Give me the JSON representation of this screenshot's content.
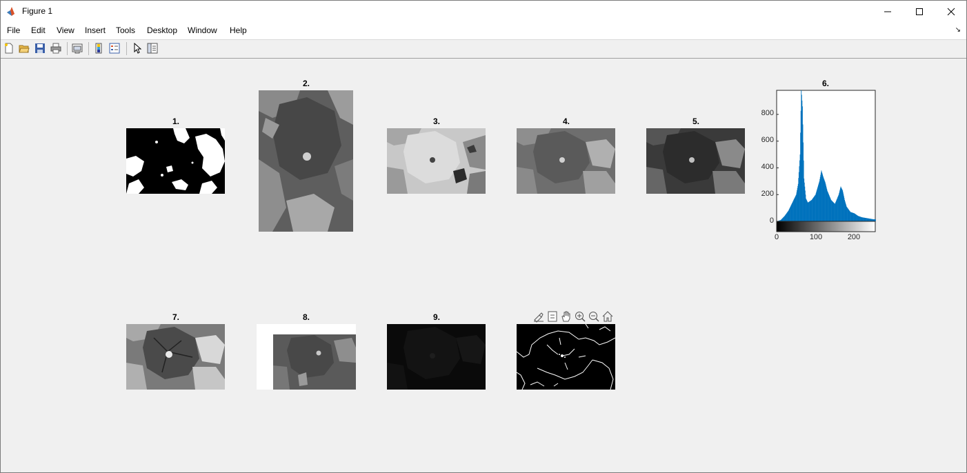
{
  "window": {
    "title": "Figure 1",
    "buttons": [
      "minimize",
      "maximize",
      "close"
    ]
  },
  "menu": {
    "items": [
      "File",
      "Edit",
      "View",
      "Insert",
      "Tools",
      "Desktop",
      "Window",
      "Help"
    ]
  },
  "toolbar": {
    "buttons": [
      "new-figure-icon",
      "open-file-icon",
      "save-icon",
      "print-icon",
      "link-plot-icon",
      "insert-colorbar-icon",
      "insert-legend-icon",
      "edit-plot-icon",
      "property-inspector-icon"
    ]
  },
  "subplots": {
    "t1": "1.",
    "t2": "2.",
    "t3": "3.",
    "t4": "4.",
    "t5": "5.",
    "t6": "6.",
    "t7": "7.",
    "t8": "8.",
    "t9": "9."
  },
  "histogram": {
    "yticks": [
      "0",
      "200",
      "400",
      "600",
      "800"
    ],
    "xticks": [
      "0",
      "100",
      "200"
    ]
  },
  "axes_toolbar": [
    "brush-icon",
    "data-tips-icon",
    "pan-icon",
    "zoom-in-icon",
    "zoom-out-icon",
    "home-icon"
  ],
  "chart_data": {
    "type": "bar",
    "title": "6.",
    "xlabel": "",
    "ylabel": "",
    "xlim": [
      0,
      255
    ],
    "ylim": [
      0,
      980
    ],
    "x": [
      0,
      10,
      20,
      30,
      40,
      50,
      55,
      60,
      63,
      66,
      70,
      75,
      80,
      90,
      100,
      110,
      115,
      120,
      125,
      130,
      140,
      150,
      160,
      165,
      170,
      175,
      180,
      190,
      200,
      210,
      220,
      230,
      240,
      250
    ],
    "values": [
      0,
      10,
      40,
      80,
      140,
      200,
      280,
      500,
      990,
      860,
      320,
      170,
      140,
      160,
      200,
      300,
      380,
      330,
      290,
      230,
      160,
      130,
      200,
      260,
      230,
      160,
      110,
      70,
      60,
      40,
      30,
      25,
      20,
      15
    ],
    "colors": {
      "bar": "#0072bd"
    }
  }
}
